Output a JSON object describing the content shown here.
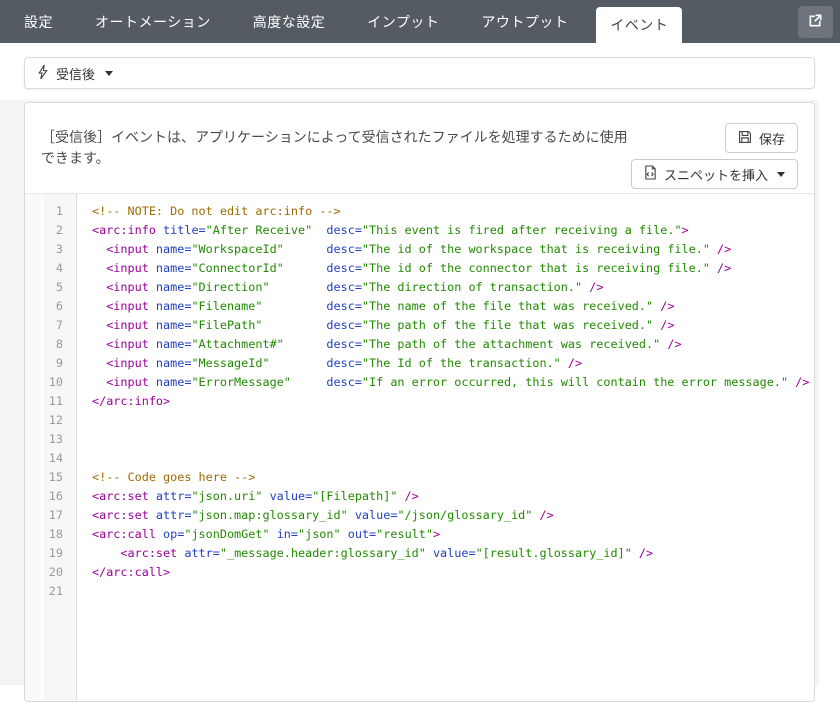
{
  "navbar": {
    "tabs": [
      {
        "label": "設定",
        "active": false
      },
      {
        "label": "オートメーション",
        "active": false
      },
      {
        "label": "高度な設定",
        "active": false
      },
      {
        "label": "インプット",
        "active": false
      },
      {
        "label": "アウトプット",
        "active": false
      },
      {
        "label": "イベント",
        "active": true
      }
    ],
    "external_link_icon": "external-link-icon"
  },
  "event_selector": {
    "icon": "lightning-bolt-icon",
    "label": "受信後",
    "caret_icon": "caret-down-icon"
  },
  "panel": {
    "description": "［受信後］イベントは、アプリケーションによって受信されたファイルを処理するために使用できます。",
    "save_button": {
      "icon": "floppy-disk-icon",
      "label": "保存"
    },
    "snippet_button": {
      "icon": "file-snippet-icon",
      "label": "スニペットを挿入",
      "caret_icon": "caret-down-icon"
    }
  },
  "editor": {
    "lines": [
      {
        "num": 1,
        "tokens": [
          [
            "c",
            "<!-- NOTE: Do not edit arc:info -->"
          ]
        ]
      },
      {
        "num": 2,
        "tokens": [
          [
            "t",
            "<arc:info "
          ],
          [
            "a",
            "title="
          ],
          [
            "s",
            "\"After Receive\""
          ],
          [
            "p",
            "  "
          ],
          [
            "a",
            "desc="
          ],
          [
            "s",
            "\"This event is fired after receiving a file.\""
          ],
          [
            "t",
            ">"
          ]
        ]
      },
      {
        "num": 3,
        "tokens": [
          [
            "t",
            "  <input "
          ],
          [
            "a",
            "name="
          ],
          [
            "s",
            "\"WorkspaceId\""
          ],
          [
            "p",
            "      "
          ],
          [
            "a",
            "desc="
          ],
          [
            "s",
            "\"The id of the workspace that is receiving file.\""
          ],
          [
            "t",
            " />"
          ]
        ]
      },
      {
        "num": 4,
        "tokens": [
          [
            "t",
            "  <input "
          ],
          [
            "a",
            "name="
          ],
          [
            "s",
            "\"ConnectorId\""
          ],
          [
            "p",
            "      "
          ],
          [
            "a",
            "desc="
          ],
          [
            "s",
            "\"The id of the connector that is receiving file.\""
          ],
          [
            "t",
            " />"
          ]
        ]
      },
      {
        "num": 5,
        "tokens": [
          [
            "t",
            "  <input "
          ],
          [
            "a",
            "name="
          ],
          [
            "s",
            "\"Direction\""
          ],
          [
            "p",
            "        "
          ],
          [
            "a",
            "desc="
          ],
          [
            "s",
            "\"The direction of transaction.\""
          ],
          [
            "t",
            " />"
          ]
        ]
      },
      {
        "num": 6,
        "tokens": [
          [
            "t",
            "  <input "
          ],
          [
            "a",
            "name="
          ],
          [
            "s",
            "\"Filename\""
          ],
          [
            "p",
            "         "
          ],
          [
            "a",
            "desc="
          ],
          [
            "s",
            "\"The name of the file that was received.\""
          ],
          [
            "t",
            " />"
          ]
        ]
      },
      {
        "num": 7,
        "tokens": [
          [
            "t",
            "  <input "
          ],
          [
            "a",
            "name="
          ],
          [
            "s",
            "\"FilePath\""
          ],
          [
            "p",
            "         "
          ],
          [
            "a",
            "desc="
          ],
          [
            "s",
            "\"The path of the file that was received.\""
          ],
          [
            "t",
            " />"
          ]
        ]
      },
      {
        "num": 8,
        "tokens": [
          [
            "t",
            "  <input "
          ],
          [
            "a",
            "name="
          ],
          [
            "s",
            "\"Attachment#\""
          ],
          [
            "p",
            "      "
          ],
          [
            "a",
            "desc="
          ],
          [
            "s",
            "\"The path of the attachment was received.\""
          ],
          [
            "t",
            " />"
          ]
        ]
      },
      {
        "num": 9,
        "tokens": [
          [
            "t",
            "  <input "
          ],
          [
            "a",
            "name="
          ],
          [
            "s",
            "\"MessageId\""
          ],
          [
            "p",
            "        "
          ],
          [
            "a",
            "desc="
          ],
          [
            "s",
            "\"The Id of the transaction.\""
          ],
          [
            "t",
            " />"
          ]
        ]
      },
      {
        "num": 10,
        "tokens": [
          [
            "t",
            "  <input "
          ],
          [
            "a",
            "name="
          ],
          [
            "s",
            "\"ErrorMessage\""
          ],
          [
            "p",
            "     "
          ],
          [
            "a",
            "desc="
          ],
          [
            "s",
            "\"If an error occurred, this will contain the error message.\""
          ],
          [
            "t",
            " />"
          ]
        ]
      },
      {
        "num": 11,
        "tokens": [
          [
            "t",
            "</arc:info>"
          ]
        ]
      },
      {
        "num": 12,
        "tokens": []
      },
      {
        "num": 13,
        "tokens": []
      },
      {
        "num": 14,
        "tokens": []
      },
      {
        "num": 15,
        "tokens": [
          [
            "c",
            "<!-- Code goes here -->"
          ]
        ]
      },
      {
        "num": 16,
        "tokens": [
          [
            "t",
            "<arc:set "
          ],
          [
            "a",
            "attr="
          ],
          [
            "s",
            "\"json.uri\""
          ],
          [
            "p",
            " "
          ],
          [
            "a",
            "value="
          ],
          [
            "s",
            "\"[Filepath]\""
          ],
          [
            "t",
            " />"
          ]
        ]
      },
      {
        "num": 17,
        "tokens": [
          [
            "t",
            "<arc:set "
          ],
          [
            "a",
            "attr="
          ],
          [
            "s",
            "\"json.map:glossary_id\""
          ],
          [
            "p",
            " "
          ],
          [
            "a",
            "value="
          ],
          [
            "s",
            "\"/json/glossary_id\""
          ],
          [
            "t",
            " />"
          ]
        ]
      },
      {
        "num": 18,
        "tokens": [
          [
            "t",
            "<arc:call "
          ],
          [
            "a",
            "op="
          ],
          [
            "s",
            "\"jsonDomGet\""
          ],
          [
            "p",
            " "
          ],
          [
            "a",
            "in="
          ],
          [
            "s",
            "\"json\""
          ],
          [
            "p",
            " "
          ],
          [
            "a",
            "out="
          ],
          [
            "s",
            "\"result\""
          ],
          [
            "t",
            ">"
          ]
        ]
      },
      {
        "num": 19,
        "tokens": [
          [
            "p",
            "    "
          ],
          [
            "t",
            "<arc:set "
          ],
          [
            "a",
            "attr="
          ],
          [
            "s",
            "\"_message.header:glossary_id\""
          ],
          [
            "p",
            " "
          ],
          [
            "a",
            "value="
          ],
          [
            "s",
            "\"[result.glossary_id]\""
          ],
          [
            "t",
            " />"
          ]
        ]
      },
      {
        "num": 20,
        "tokens": [
          [
            "t",
            "</arc:call>"
          ]
        ]
      },
      {
        "num": 21,
        "tokens": []
      }
    ]
  },
  "colors": {
    "navbar_bg": "#555b62",
    "page_bg": "#f4f4f5",
    "gutter_bg": "#f7f7f7",
    "line_number": "#999999",
    "tag": "#990099",
    "attribute": "#2140c0",
    "string": "#218a00",
    "comment": "#9c6a00"
  }
}
